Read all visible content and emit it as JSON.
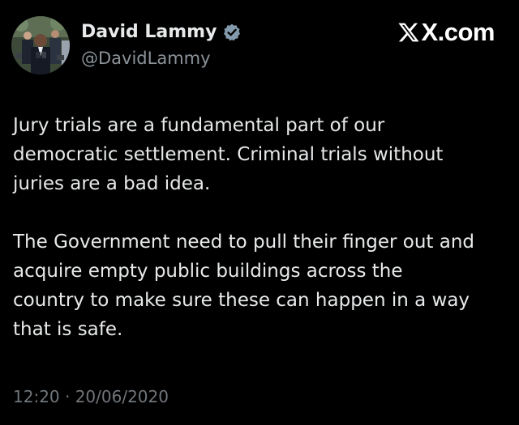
{
  "author": {
    "display_name": "David Lammy",
    "handle": "@DavidLammy",
    "verified": true,
    "avatar_icon": "profile-photo"
  },
  "brand": {
    "text": "X.com",
    "icon": "x-logo-icon"
  },
  "tweet": {
    "paragraphs": [
      {
        "lines": [
          "Jury trials are a fundamental part of our",
          "democratic settlement. Criminal trials without",
          "juries are a bad idea."
        ]
      },
      {
        "lines": [
          "The Government need to pull their finger out and",
          "acquire empty public buildings across the",
          "country to make sure these can happen in a way",
          "that is safe."
        ]
      }
    ],
    "timestamp": "12:20 · 20/06/2020"
  },
  "colors": {
    "background": "#000000",
    "text_primary": "#e7e9ea",
    "text_secondary": "#71767b",
    "verified_badge": "#829aab"
  }
}
